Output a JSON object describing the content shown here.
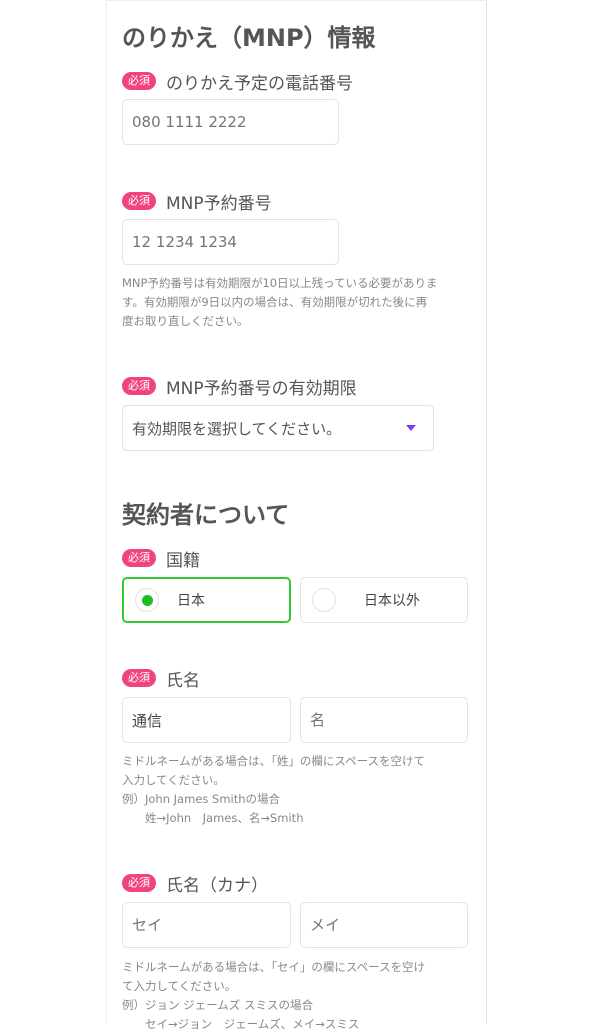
{
  "required_badge": "必須",
  "mnp": {
    "title": "のりかえ（MNP）情報",
    "phone": {
      "label": "のりかえ予定の電話番号",
      "placeholder": "080 1111 2222"
    },
    "number": {
      "label": "MNP予約番号",
      "placeholder": "12 1234 1234",
      "help": [
        "MNP予約番号は有効期限が10日以上残っている必要がありま",
        "す。有効期限が9日以内の場合は、有効期限が切れた後に再",
        "度お取り直しください。"
      ]
    },
    "expiry": {
      "label": "MNP予約番号の有効期限",
      "selected": "有効期限を選択してください。",
      "arrow_color": "#7b3cf0"
    }
  },
  "contractor": {
    "title": "契約者について",
    "nationality": {
      "label": "国籍",
      "options": [
        {
          "label": "日本",
          "selected": true
        },
        {
          "label": "日本以外",
          "selected": false
        }
      ]
    },
    "name": {
      "label": "氏名",
      "last_value": "通信",
      "first_placeholder": "名",
      "help": [
        "ミドルネームがある場合は、「姓」の欄にスペースを空けて",
        "入力してください。",
        "例）John James Smithの場合",
        "　　姓→John　James、名→Smith"
      ]
    },
    "kana": {
      "label": "氏名（カナ）",
      "last_placeholder": "セイ",
      "first_placeholder": "メイ",
      "help": [
        "ミドルネームがある場合は、「セイ」の欄にスペースを空け",
        "て入力してください。",
        "例）ジョン ジェームズ スミスの場合",
        "　　セイ→ジョン　ジェームズ、メイ→スミス"
      ]
    }
  },
  "colors": {
    "badge": "#f0447e",
    "selected_radio": "#2ecc2e"
  }
}
